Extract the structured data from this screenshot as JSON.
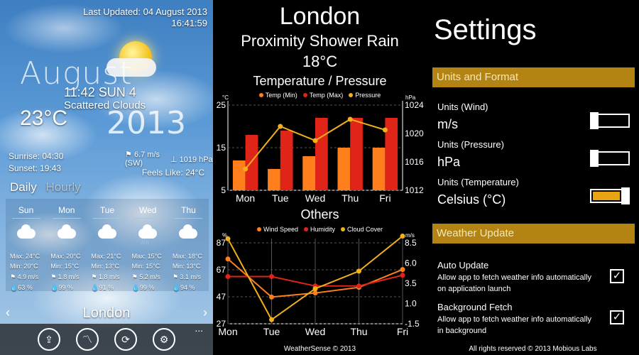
{
  "home": {
    "updated_label": "Last Updated:  04 August 2013",
    "updated_time": "16:41:59",
    "month": "August",
    "year": "2013",
    "time": "11:42 SUN 4",
    "condition": "Scattered Clouds",
    "temperature": "23°C",
    "sunrise": "Sunrise: 04:30",
    "sunset": "Sunset: 19:43",
    "wind_speed": "6.7 m/s",
    "wind_dir": "(SW)",
    "pressure": "1019 hPa",
    "feels_like": "Feels Like: 24°C",
    "tabs": [
      "Daily",
      "Hourly"
    ],
    "city": "London",
    "more": "...",
    "forecast": [
      {
        "day": "Sun",
        "max": "Max: 24°C",
        "min": "Min: 20°C",
        "wind": "4.9 m/s",
        "humidity": "63 %",
        "rain": false
      },
      {
        "day": "Mon",
        "max": "Max: 20°C",
        "min": "Min: 15°C",
        "wind": "1.8 m/s",
        "humidity": "99 %",
        "rain": true
      },
      {
        "day": "Tue",
        "max": "Max: 21°C",
        "min": "Min: 13°C",
        "wind": "1.8 m/s",
        "humidity": "91 %",
        "rain": false
      },
      {
        "day": "Wed",
        "max": "Max: 15°C",
        "min": "Min: 15°C",
        "wind": "5.2 m/s",
        "humidity": "99 %",
        "rain": true
      },
      {
        "day": "Thu",
        "max": "Max: 18°C",
        "min": "Min: 13°C",
        "wind": "3.1 m/s",
        "humidity": "94 %",
        "rain": false
      }
    ],
    "appbar_icons": [
      "share-icon",
      "chart-icon",
      "refresh-icon",
      "settings-icon"
    ]
  },
  "detail": {
    "city": "London",
    "forecast": "Proximity Shower Rain",
    "temperature": "18°C",
    "chart1_title": "Temperature / Pressure",
    "chart2_title": "Others",
    "footer": "WeatherSense © 2013"
  },
  "chart_data": [
    {
      "type": "bar",
      "title": "Temperature / Pressure",
      "categories": [
        "Mon",
        "Tue",
        "Wed",
        "Thu",
        "Fri"
      ],
      "y_left_label": "°C",
      "y_left_ticks": [
        "25",
        "15",
        "5"
      ],
      "y_left_range": [
        5,
        25
      ],
      "y_right_label": "hPa",
      "y_right_ticks": [
        "1024",
        "1020",
        "1016",
        "1012"
      ],
      "y_right_range": [
        1012,
        1024
      ],
      "series": [
        {
          "name": "Temp (Min)",
          "color": "#ff7f1c",
          "values": [
            12,
            10,
            13,
            15,
            15
          ]
        },
        {
          "name": "Temp (Max)",
          "color": "#e02418",
          "values": [
            18,
            19,
            22,
            22,
            22
          ]
        },
        {
          "name": "Pressure",
          "color": "#f2b11c",
          "values": [
            1015,
            1021,
            1019,
            1022,
            1020.5
          ],
          "axis": "right",
          "kind": "line"
        }
      ]
    },
    {
      "type": "line",
      "title": "Others",
      "categories": [
        "Mon",
        "Tue",
        "Wed",
        "Thu",
        "Fri"
      ],
      "y_left_label": "%",
      "y_left_ticks": [
        "87",
        "67",
        "47",
        "27"
      ],
      "y_left_range": [
        27,
        87
      ],
      "y_right_label": "m/s",
      "y_right_ticks": [
        "8.5",
        "6.0",
        "3.5",
        "1.0",
        "-1.5"
      ],
      "y_right_range": [
        -1.5,
        8.5
      ],
      "series": [
        {
          "name": "Wind Speed",
          "color": "#ff7f1c",
          "values": [
            6.5,
            1.8,
            2.3,
            3.0,
            5.2
          ],
          "axis": "right"
        },
        {
          "name": "Humidity",
          "color": "#e02418",
          "values": [
            62,
            62,
            55,
            55,
            63
          ],
          "axis": "left"
        },
        {
          "name": "Cloud Cover",
          "color": "#f2b11c",
          "values": [
            90,
            30,
            53,
            66,
            92
          ],
          "axis": "left"
        }
      ]
    }
  ],
  "settings": {
    "title": "Settings",
    "section_units": "Units and Format",
    "wind_label": "Units (Wind)",
    "wind_value": "m/s",
    "pressure_label": "Units (Pressure)",
    "pressure_value": "hPa",
    "temp_label": "Units (Temperature)",
    "temp_value": "Celsius (°C)",
    "section_update": "Weather Update",
    "auto_title": "Auto Update",
    "auto_desc": "Allow app to fetch weather info automatically on application launch",
    "bg_title": "Background Fetch",
    "bg_desc": "Allow app to fetch weather info automatically in background",
    "check_mark": "✓",
    "rights": "All rights reserved © 2013 Mobious Labs",
    "accent": "#b38414"
  }
}
